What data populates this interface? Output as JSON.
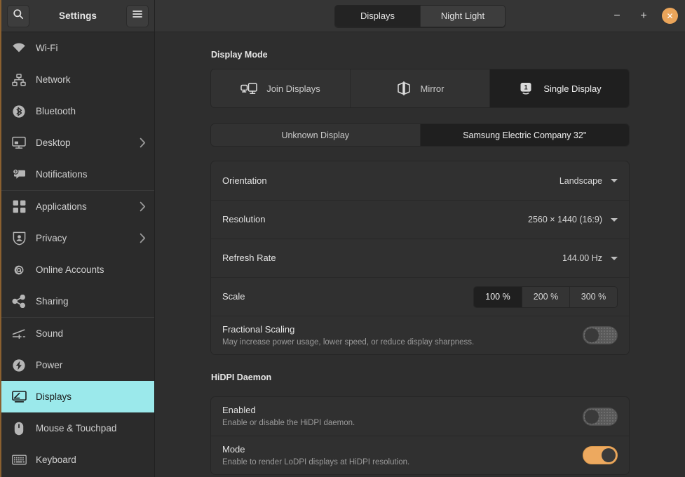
{
  "sidebar": {
    "title": "Settings",
    "search_icon": "search-icon",
    "menu_icon": "hamburger-menu-icon",
    "items": [
      {
        "label": "Wi-Fi",
        "icon": "wifi-icon",
        "chevron": false,
        "selected": false,
        "sep_after": false
      },
      {
        "label": "Network",
        "icon": "network-icon",
        "chevron": false,
        "selected": false,
        "sep_after": false
      },
      {
        "label": "Bluetooth",
        "icon": "bluetooth-icon",
        "chevron": false,
        "selected": false,
        "sep_after": false
      },
      {
        "label": "Desktop",
        "icon": "desktop-icon",
        "chevron": true,
        "selected": false,
        "sep_after": false
      },
      {
        "label": "Notifications",
        "icon": "notifications-icon",
        "chevron": false,
        "selected": false,
        "sep_after": true
      },
      {
        "label": "Applications",
        "icon": "applications-icon",
        "chevron": true,
        "selected": false,
        "sep_after": false
      },
      {
        "label": "Privacy",
        "icon": "privacy-icon",
        "chevron": true,
        "selected": false,
        "sep_after": false
      },
      {
        "label": "Online Accounts",
        "icon": "online-accounts-icon",
        "chevron": false,
        "selected": false,
        "sep_after": false
      },
      {
        "label": "Sharing",
        "icon": "sharing-icon",
        "chevron": false,
        "selected": false,
        "sep_after": true
      },
      {
        "label": "Sound",
        "icon": "sound-icon",
        "chevron": false,
        "selected": false,
        "sep_after": false
      },
      {
        "label": "Power",
        "icon": "power-icon",
        "chevron": false,
        "selected": false,
        "sep_after": false
      },
      {
        "label": "Displays",
        "icon": "displays-icon",
        "chevron": false,
        "selected": true,
        "sep_after": false
      },
      {
        "label": "Mouse & Touchpad",
        "icon": "mouse-icon",
        "chevron": false,
        "selected": false,
        "sep_after": false
      },
      {
        "label": "Keyboard",
        "icon": "keyboard-icon",
        "chevron": false,
        "selected": false,
        "sep_after": false
      }
    ]
  },
  "titlebar": {
    "tabs": [
      {
        "label": "Displays",
        "active": true
      },
      {
        "label": "Night Light",
        "active": false
      }
    ],
    "minimize_label": "−",
    "maximize_label": "+",
    "close_label": "✕"
  },
  "main": {
    "display_mode": {
      "heading": "Display Mode",
      "options": [
        {
          "label": "Join Displays",
          "icon": "join-displays-icon",
          "active": false
        },
        {
          "label": "Mirror",
          "icon": "mirror-icon",
          "active": false
        },
        {
          "label": "Single Display",
          "icon": "single-display-icon",
          "active": true
        }
      ]
    },
    "display_picker": {
      "options": [
        {
          "label": "Unknown Display",
          "active": false
        },
        {
          "label": "Samsung Electric Company 32\"",
          "active": true
        }
      ]
    },
    "display_settings": {
      "orientation": {
        "label": "Orientation",
        "value": "Landscape"
      },
      "resolution": {
        "label": "Resolution",
        "value": "2560 × 1440 (16:9)"
      },
      "refresh_rate": {
        "label": "Refresh Rate",
        "value": "144.00 Hz"
      },
      "scale": {
        "label": "Scale",
        "options": [
          {
            "label": "100 %",
            "active": true
          },
          {
            "label": "200 %",
            "active": false
          },
          {
            "label": "300 %",
            "active": false
          }
        ]
      },
      "fractional_scaling": {
        "label": "Fractional Scaling",
        "description": "May increase power usage, lower speed, or reduce display sharpness.",
        "enabled": false
      }
    },
    "hidpi_daemon": {
      "heading": "HiDPI Daemon",
      "rows": [
        {
          "label": "Enabled",
          "description": "Enable or disable the HiDPI daemon.",
          "enabled": false
        },
        {
          "label": "Mode",
          "description": "Enable to render LoDPI displays at HiDPI resolution.",
          "enabled": true
        }
      ]
    }
  },
  "colors": {
    "accent_selected": "#9BE9EB",
    "accent_orange": "#EDA95F",
    "window_bg": "#2E2E2E",
    "sidebar_bg": "#2B2B2B",
    "header_bg": "#353535",
    "card_bg": "#303030",
    "active_segment_bg": "#1F1F1F"
  }
}
